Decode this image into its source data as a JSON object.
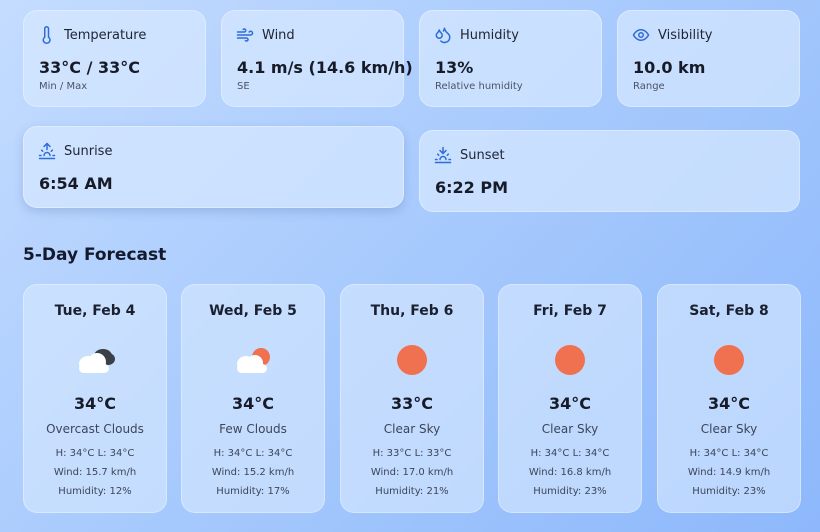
{
  "stats": [
    {
      "label": "Temperature",
      "value": "33°C / 33°C",
      "sub": "Min / Max",
      "icon": "thermometer-icon"
    },
    {
      "label": "Wind",
      "value": "4.1 m/s (14.6 km/h)",
      "sub": "SE",
      "icon": "wind-icon"
    },
    {
      "label": "Humidity",
      "value": "13%",
      "sub": "Relative humidity",
      "icon": "droplets-icon"
    },
    {
      "label": "Visibility",
      "value": "10.0 km",
      "sub": "Range",
      "icon": "eye-icon"
    }
  ],
  "sunrise": {
    "label": "Sunrise",
    "value": "6:54 AM",
    "icon": "sunrise-icon"
  },
  "sunset": {
    "label": "Sunset",
    "value": "6:22 PM",
    "icon": "sunset-icon"
  },
  "forecast_title": "5-Day Forecast",
  "forecast": [
    {
      "date": "Tue, Feb 4",
      "icon": "overcast-clouds-icon",
      "temp": "34°C",
      "desc": "Overcast Clouds",
      "hilo": "H: 34°C L: 34°C",
      "wind": "Wind: 15.7 km/h",
      "humidity": "Humidity: 12%"
    },
    {
      "date": "Wed, Feb 5",
      "icon": "few-clouds-icon",
      "temp": "34°C",
      "desc": "Few Clouds",
      "hilo": "H: 34°C L: 34°C",
      "wind": "Wind: 15.2 km/h",
      "humidity": "Humidity: 17%"
    },
    {
      "date": "Thu, Feb 6",
      "icon": "clear-sky-sun-icon",
      "temp": "33°C",
      "desc": "Clear Sky",
      "hilo": "H: 33°C L: 33°C",
      "wind": "Wind: 17.0 km/h",
      "humidity": "Humidity: 21%"
    },
    {
      "date": "Fri, Feb 7",
      "icon": "clear-sky-sun-icon",
      "temp": "34°C",
      "desc": "Clear Sky",
      "hilo": "H: 34°C L: 34°C",
      "wind": "Wind: 16.8 km/h",
      "humidity": "Humidity: 23%"
    },
    {
      "date": "Sat, Feb 8",
      "icon": "clear-sky-sun-icon",
      "temp": "34°C",
      "desc": "Clear Sky",
      "hilo": "H: 34°C L: 34°C",
      "wind": "Wind: 14.9 km/h",
      "humidity": "Humidity: 23%"
    }
  ],
  "colors": {
    "accent": "#2e6cd8",
    "sun": "#f0714f",
    "dark_cloud": "#3b3f47",
    "background": "#a9cbfd"
  }
}
